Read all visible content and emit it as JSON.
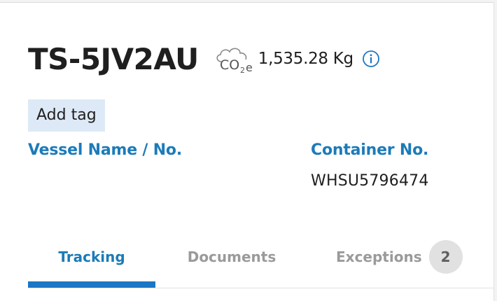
{
  "shipment": {
    "id": "TS-5JV2AU",
    "emissions_value": "1,535.28 Kg",
    "emissions_icon": "co2e-cloud-icon",
    "info_icon": "info-circle-icon"
  },
  "add_tag_label": "Add tag",
  "fields": {
    "vessel": {
      "label": "Vessel Name / No.",
      "value": ""
    },
    "container": {
      "label": "Container No.",
      "value": "WHSU5796474"
    }
  },
  "tabs": [
    {
      "label": "Tracking",
      "active": true
    },
    {
      "label": "Documents",
      "active": false
    },
    {
      "label": "Exceptions",
      "active": false,
      "count": "2"
    }
  ],
  "colors": {
    "accent": "#1c7bb8",
    "active_tab_indicator": "#1b76c4",
    "tag_background": "#dde9f6",
    "inactive_tab": "#9a9a9a",
    "badge_background": "#e1e1e1"
  }
}
